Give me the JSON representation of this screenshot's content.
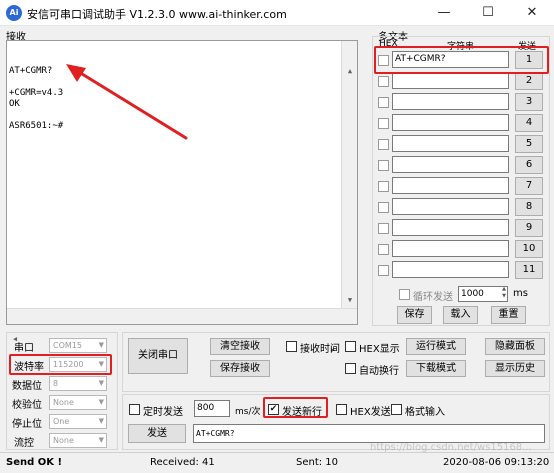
{
  "window": {
    "title": "安信可串口调试助手 V1.2.3.0     www.ai-thinker.com",
    "logo": "Ai",
    "minimize": "—",
    "maximize": "☐",
    "close": "✕"
  },
  "receive": {
    "label": "接收",
    "content": "AT+CGMR?\n\n+CGMR=v4.3\nOK\n\nASR6501:~#"
  },
  "multitext": {
    "label": "多文本",
    "col_hex": "HEX",
    "col_string": "字符串",
    "col_send": "发送",
    "rows": [
      {
        "value": "AT+CGMR?",
        "button": "1"
      },
      {
        "value": "",
        "button": "2"
      },
      {
        "value": "",
        "button": "3"
      },
      {
        "value": "",
        "button": "4"
      },
      {
        "value": "",
        "button": "5"
      },
      {
        "value": "",
        "button": "6"
      },
      {
        "value": "",
        "button": "7"
      },
      {
        "value": "",
        "button": "8"
      },
      {
        "value": "",
        "button": "9"
      },
      {
        "value": "",
        "button": "10"
      },
      {
        "value": "",
        "button": "11"
      }
    ],
    "loop_send_label": "循环发送",
    "loop_interval": "1000",
    "loop_unit": "ms",
    "save_button": "保存",
    "load_button": "载入",
    "reset_button": "重置"
  },
  "serial": {
    "port_label": "串口",
    "port_value": "COM15",
    "baud_label": "波特率",
    "baud_value": "115200",
    "databits_label": "数据位",
    "databits_value": "8",
    "parity_label": "校验位",
    "parity_value": "None",
    "stopbits_label": "停止位",
    "stopbits_value": "One",
    "flow_label": "流控",
    "flow_value": "None",
    "close_port_button": "关闭串口"
  },
  "options": {
    "clear_receive": "清空接收",
    "save_receive": "保存接收",
    "recv_time": "接收时间",
    "hex_display": "HEX显示",
    "run_mode": "运行模式",
    "hide_panel": "隐藏面板",
    "auto_wrap": "自动换行",
    "download_mode": "下载模式",
    "show_history": "显示历史"
  },
  "send": {
    "timed_send": "定时发送",
    "interval": "800",
    "interval_unit": "ms/次",
    "newline": "发送新行",
    "newline_checked": "✔",
    "hex_send": "HEX发送",
    "format_input": "格式输入",
    "send_button": "发送",
    "input_value": "AT+CGMR?"
  },
  "status": {
    "state": "Send OK !",
    "received": "Received: 41",
    "sent": "Sent: 10",
    "datetime": "2020-08-06 09:13:20"
  },
  "watermark": "https://blog.csdn.net/ws15168...",
  "colors": {
    "annotation_red": "#e02020",
    "accent_blue": "#2b6ad6"
  }
}
